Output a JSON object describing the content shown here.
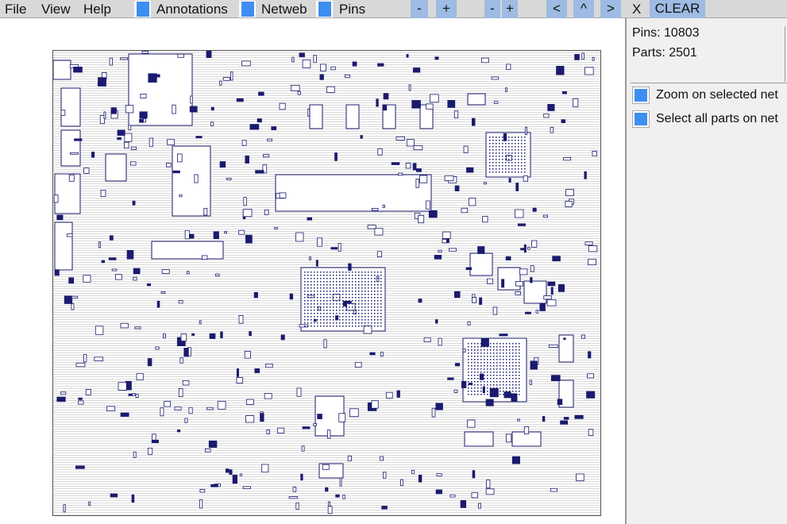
{
  "menu": {
    "file": "File",
    "view": "View",
    "help": "Help"
  },
  "toggles": {
    "annotations": "Annotations",
    "netweb": "Netweb",
    "pins": "Pins"
  },
  "buttons": {
    "zoom_out_1": "-",
    "zoom_in_1": "+",
    "zoom_out_2": "-",
    "zoom_in_2": "+",
    "prev": "<",
    "up": "^",
    "next": ">",
    "close": "X",
    "clear": "CLEAR"
  },
  "panel": {
    "pins": "Pins: 10803",
    "parts": "Parts: 2501",
    "zoom_on_selected": "Zoom on selected net",
    "select_all_parts": "Select all parts on net"
  },
  "colors": {
    "accent": "#3d8ef0",
    "button": "#9dbbe3",
    "outline": "#1a1a6e"
  }
}
